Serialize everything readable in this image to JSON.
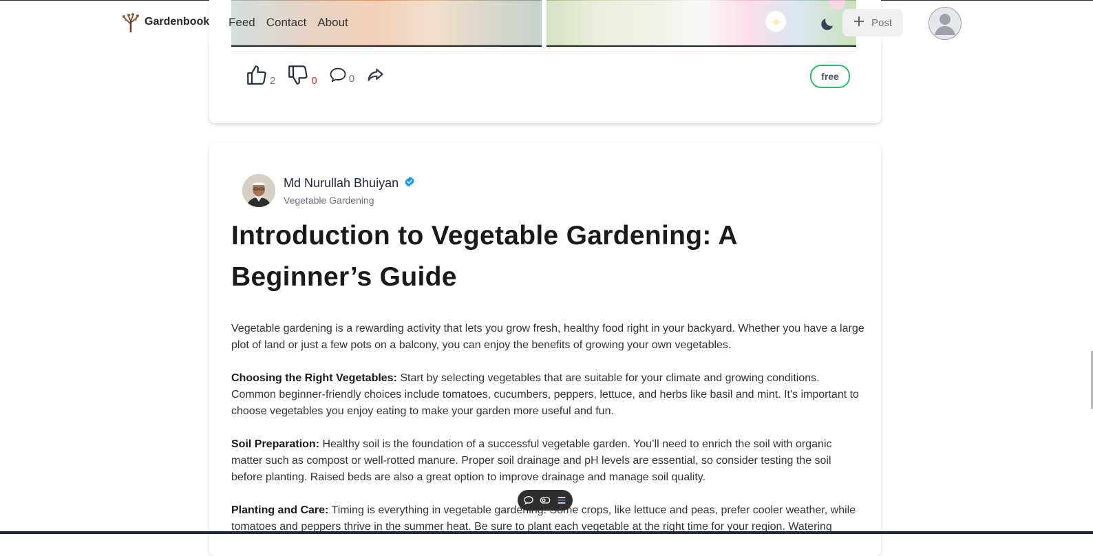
{
  "navbar": {
    "brand": "Gardenbook",
    "links": [
      "Feed",
      "Contact",
      "About"
    ],
    "post_label": "Post",
    "icons": {
      "logo": "tree-logo-icon",
      "theme": "moon-icon",
      "post": "plus-icon",
      "user": "user-avatar-icon"
    }
  },
  "prev_post": {
    "likes": "2",
    "dislikes": "0",
    "comments": "0",
    "badge": "free",
    "icons": [
      "thumbs-up-icon",
      "thumbs-down-icon",
      "comment-icon",
      "share-icon"
    ]
  },
  "article": {
    "author": "Md Nurullah Bhuiyan",
    "verified": true,
    "category": "Vegetable Gardening",
    "title": "Introduction to Vegetable Gardening: A Beginner’s Guide",
    "intro": "Vegetable gardening is a rewarding activity that lets you grow fresh, healthy food right in your backyard. Whether you have a large plot of land or just a few pots on a balcony, you can enjoy the benefits of growing your own vegetables.",
    "sections": [
      {
        "heading": "Choosing the Right Vegetables:",
        "text": " Start by selecting vegetables that are suitable for your climate and growing conditions. Common beginner-friendly choices include tomatoes, cucumbers, peppers, lettuce, and herbs like basil and mint. It's important to choose vegetables you enjoy eating to make your garden more useful and fun."
      },
      {
        "heading": "Soil Preparation:",
        "text": " Healthy soil is the foundation of a successful vegetable garden. You’ll need to enrich the soil with organic matter such as compost or well-rotted manure. Proper soil drainage and pH levels are essential, so consider testing the soil before planting. Raised beds are also a great option to improve drainage and manage soil quality."
      },
      {
        "heading": "Planting and Care:",
        "text": " Timing is everything in vegetable gardening. Some crops, like lettuce and peas, prefer cooler weather, while tomatoes and peppers thrive in the summer heat. Be sure to plant each vegetable at the right time for your region. Watering"
      }
    ]
  },
  "toolbar": {
    "icons": [
      "comment-icon",
      "toggle-icon",
      "list-icon"
    ]
  },
  "colors": {
    "accent_green": "#22c55e",
    "dislike_red": "#dc2626",
    "verified_blue": "#1d9bf0",
    "footer_bar": "#1e293b"
  }
}
